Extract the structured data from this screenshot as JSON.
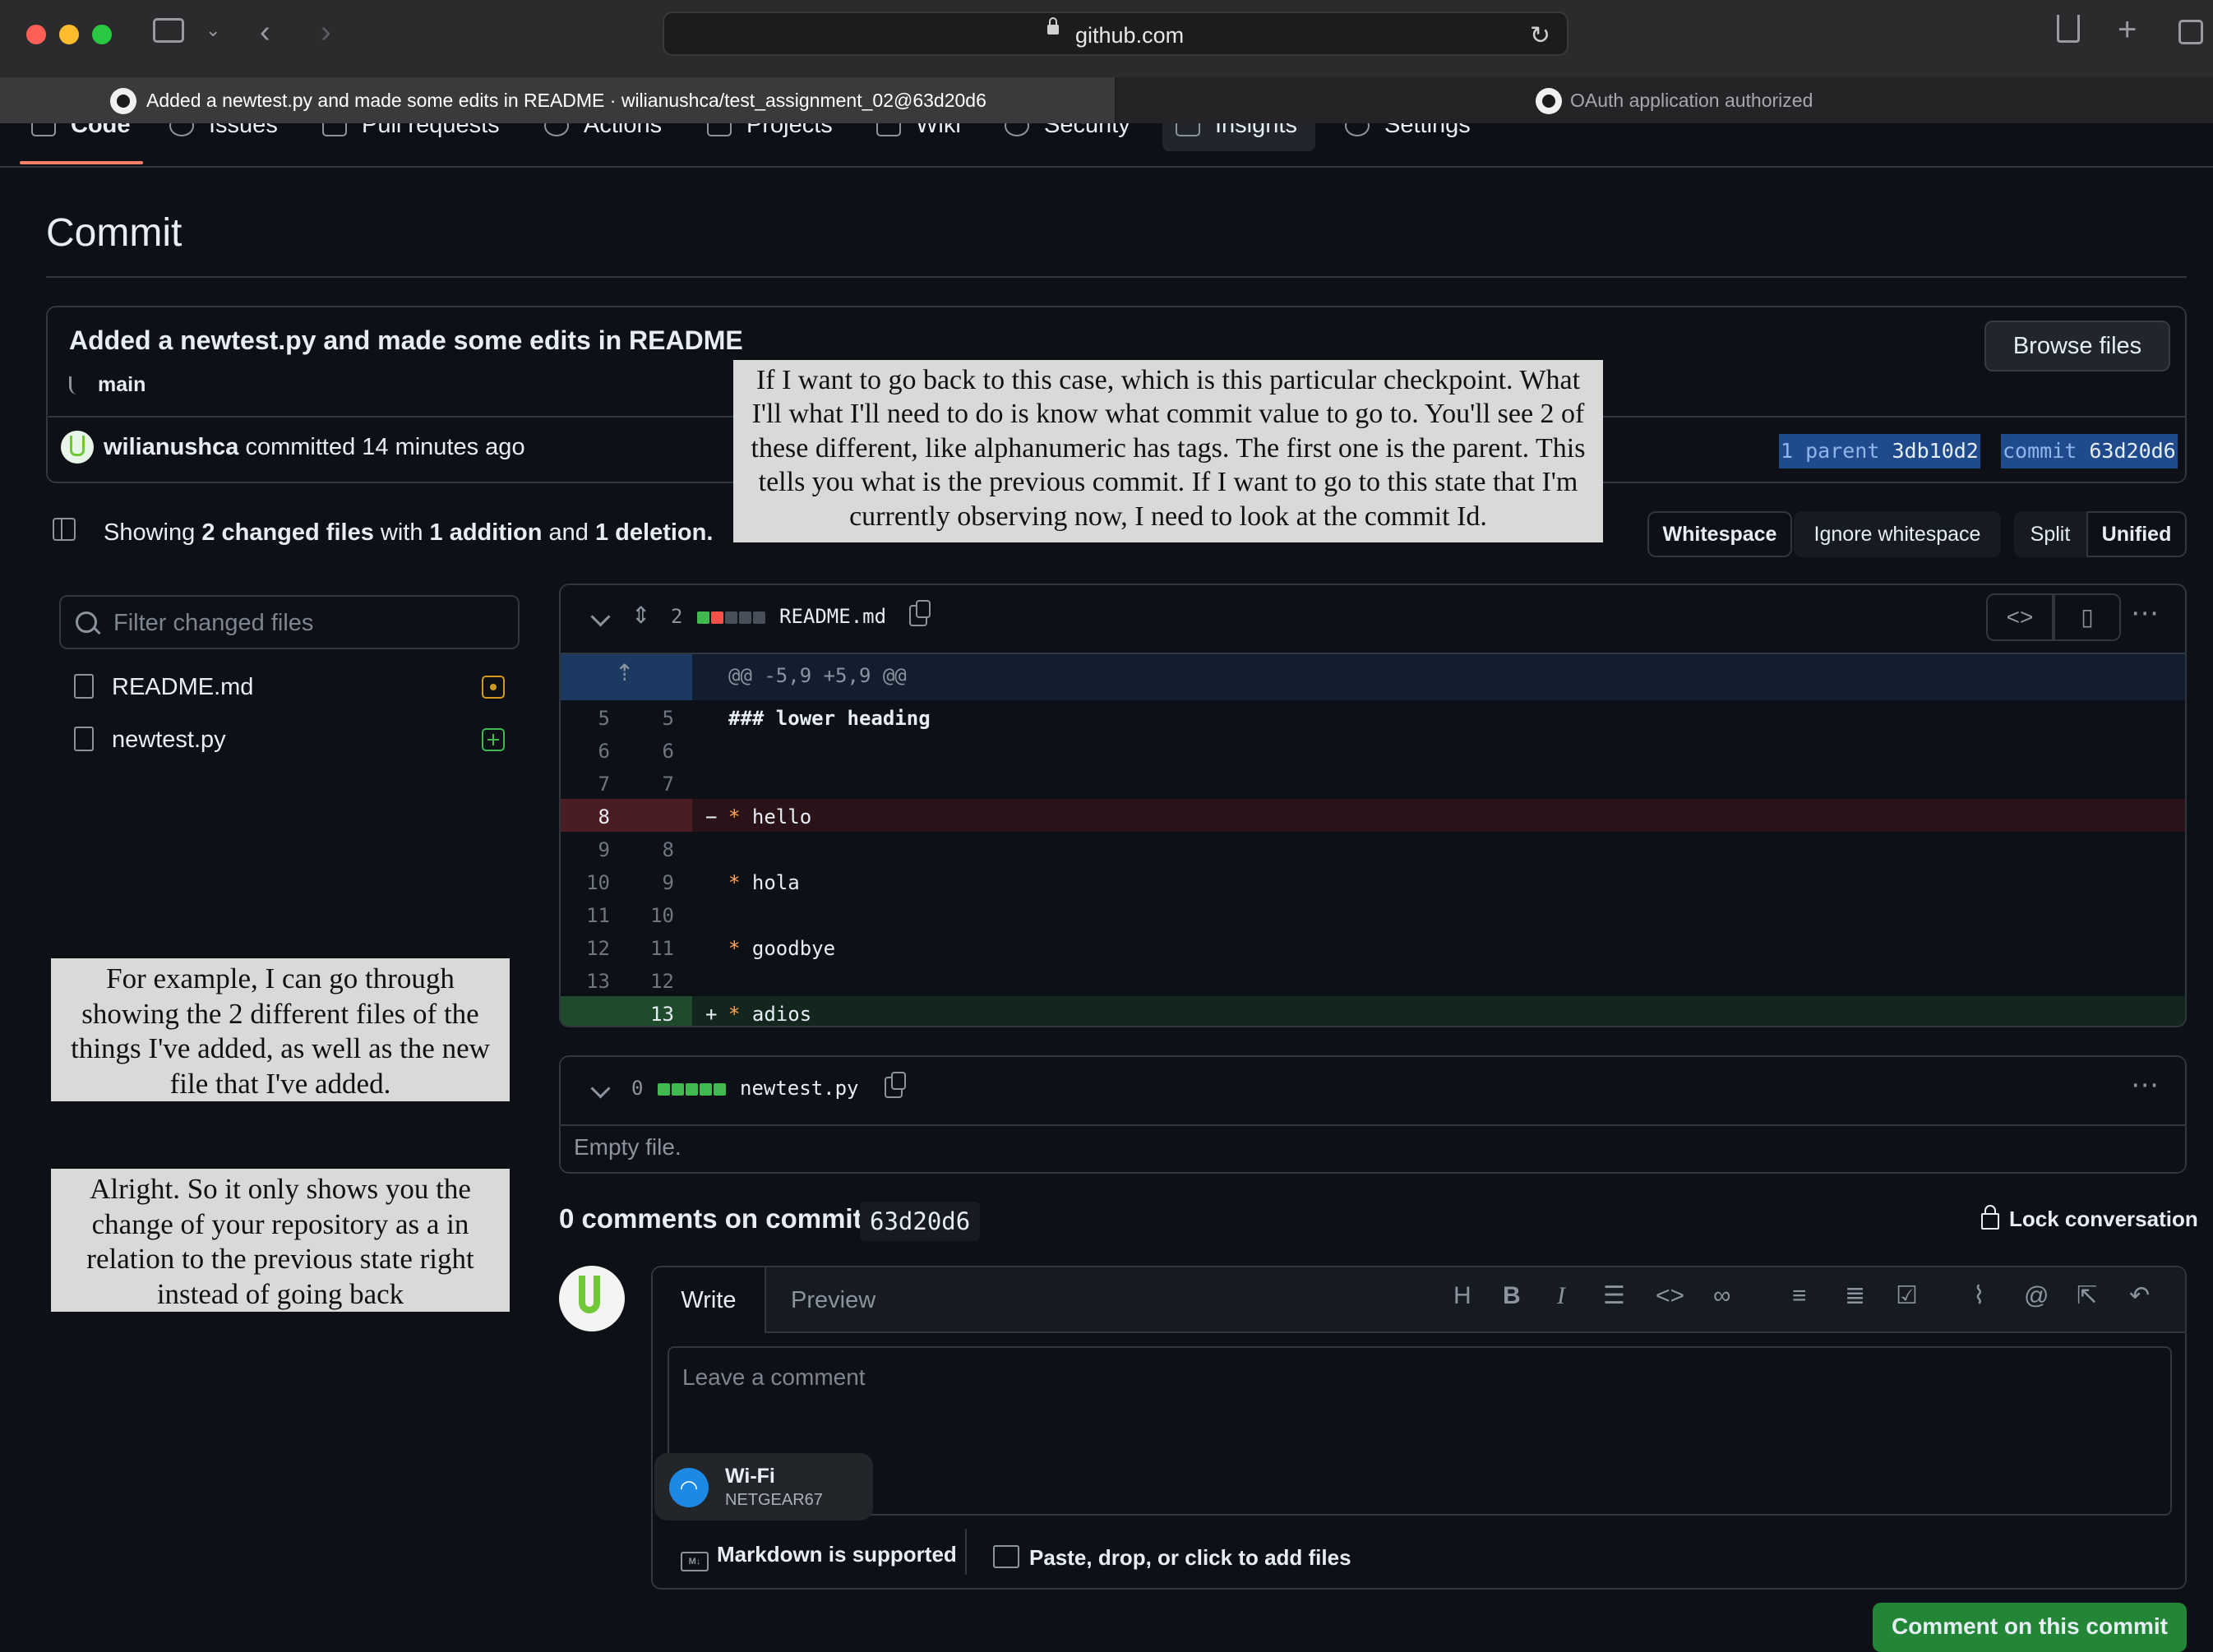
{
  "browser": {
    "url": "github.com",
    "tabs": [
      {
        "title": "Added a newtest.py and made some edits in README · wilianushca/test_assignment_02@63d20d6",
        "active": true
      },
      {
        "title": "OAuth application authorized",
        "active": false
      }
    ]
  },
  "repo_nav": {
    "items": [
      "Code",
      "Issues",
      "Pull requests",
      "Actions",
      "Projects",
      "Wiki",
      "Security",
      "Insights",
      "Settings"
    ],
    "active": "Code"
  },
  "page_title": "Commit",
  "commit": {
    "title": "Added a newtest.py and made some edits in README",
    "branch": "main",
    "browse_files_label": "Browse files",
    "author": "wilianushca",
    "committed_text": "committed 14 minutes ago",
    "parent_label": "1 parent",
    "parent_sha": "3db10d2",
    "commit_label": "commit",
    "commit_sha": "63d20d6"
  },
  "summary": {
    "prefix": "Showing",
    "changed_files": "2 changed files",
    "with": "with",
    "additions": "1 addition",
    "and": "and",
    "deletions": "1 deletion."
  },
  "view_options": {
    "whitespace": "Whitespace",
    "ignore_whitespace": "Ignore whitespace",
    "split": "Split",
    "unified": "Unified"
  },
  "file_tree": {
    "filter_placeholder": "Filter changed files",
    "files": [
      {
        "name": "README.md",
        "status": "modified"
      },
      {
        "name": "newtest.py",
        "status": "added"
      }
    ]
  },
  "diff_files": [
    {
      "count": "2",
      "name": "README.md",
      "hunk": "@@ -5,9 +5,9 @@",
      "lines": [
        {
          "old": "5",
          "new": "5",
          "type": "context",
          "sign": "",
          "text": "### lower heading"
        },
        {
          "old": "6",
          "new": "6",
          "type": "context",
          "sign": "",
          "text": ""
        },
        {
          "old": "7",
          "new": "7",
          "type": "context",
          "sign": "",
          "text": ""
        },
        {
          "old": "8",
          "new": "",
          "type": "del",
          "sign": "−",
          "text": "* hello"
        },
        {
          "old": "9",
          "new": "8",
          "type": "context",
          "sign": "",
          "text": ""
        },
        {
          "old": "10",
          "new": "9",
          "type": "context",
          "sign": "",
          "text": "* hola"
        },
        {
          "old": "11",
          "new": "10",
          "type": "context",
          "sign": "",
          "text": ""
        },
        {
          "old": "12",
          "new": "11",
          "type": "context",
          "sign": "",
          "text": "* goodbye"
        },
        {
          "old": "13",
          "new": "12",
          "type": "context",
          "sign": "",
          "text": ""
        },
        {
          "old": "",
          "new": "13",
          "type": "add",
          "sign": "+",
          "text": "* adios"
        }
      ]
    },
    {
      "count": "0",
      "name": "newtest.py",
      "empty_text": "Empty file."
    }
  ],
  "comments": {
    "title": "0 comments on commit",
    "sha": "63d20d6",
    "lock_label": "Lock conversation",
    "tab_write": "Write",
    "tab_preview": "Preview",
    "placeholder": "Leave a comment",
    "markdown_label": "Markdown is supported",
    "attach_label": "Paste, drop, or click to add files",
    "submit_label": "Comment on this commit"
  },
  "wifi_toast": {
    "title": "Wi-Fi",
    "network": "NETGEAR67"
  },
  "captions": {
    "top": "If I want to go back to this case, which is this particular checkpoint. What I'll what I'll need to do is know what commit value to go to. You'll see 2 of these different, like alphanumeric has tags. The first one is the parent. This tells you what is the previous commit. If I want to go to this state that I'm currently observing now, I need to look at the commit Id.",
    "left1": "For example, I can go through showing the 2 different files of the things I've added, as well as the new file that I've added.",
    "left2": "Alright. So it only shows you the change of your repository as a in relation to the previous state right instead of going back"
  },
  "colors": {
    "background": "#0d1117",
    "border": "#30363d",
    "accent_link": "#58a6ff",
    "deletion": "#f85149",
    "addition": "#3fb950",
    "sha_highlight": "#1f4b8c",
    "nav_underline": "#f78166"
  },
  "icons": [
    "sidebar-icon",
    "back-icon",
    "forward-icon",
    "lock-icon",
    "reload-icon",
    "share-icon",
    "new-tab-icon",
    "tabs-icon",
    "github-icon",
    "branch-icon",
    "copy-icon",
    "code-icon",
    "file-icon",
    "kebab-icon",
    "search-icon"
  ]
}
